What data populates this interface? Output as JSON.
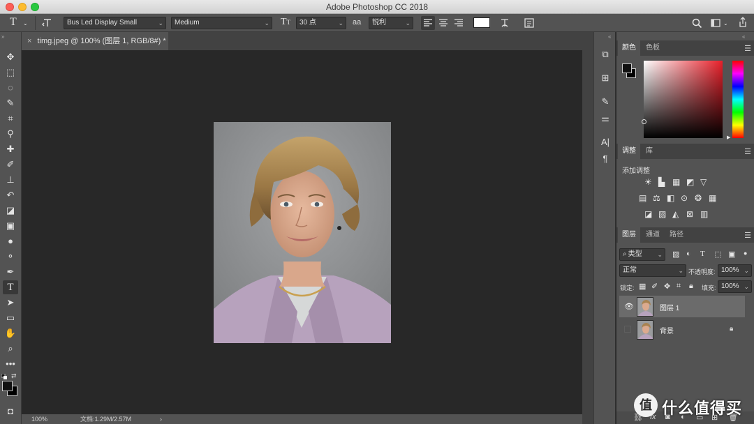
{
  "window": {
    "title": "Adobe Photoshop CC 2018"
  },
  "options_bar": {
    "font_family": "Bus Led Display Small",
    "font_style": "Medium",
    "font_size": "30 点",
    "aa_label": "aa",
    "antialias": "锐利",
    "text_color": "#ffffff"
  },
  "document": {
    "tab_title": "timg.jpeg @ 100% (图层 1, RGB/8#) *",
    "close": "×"
  },
  "status": {
    "zoom": "100%",
    "doc_info": "文档:1.29M/2.57M",
    "arrow": "›"
  },
  "panels": {
    "color": {
      "tabs": [
        "颜色",
        "色板"
      ]
    },
    "adjustments": {
      "tabs": [
        "调整",
        "库"
      ],
      "title": "添加调整"
    },
    "layers": {
      "tabs": [
        "图层",
        "通道",
        "路径"
      ],
      "filter": "类型",
      "blend_mode": "正常",
      "opacity_label": "不透明度:",
      "opacity": "100%",
      "lock_label": "锁定:",
      "fill_label": "填充:",
      "fill": "100%",
      "items": [
        {
          "name": "图层 1",
          "visible": true,
          "selected": true
        },
        {
          "name": "背景",
          "visible": false,
          "locked": true
        }
      ]
    }
  },
  "watermark": {
    "text": "什么值得买",
    "logo": "值"
  },
  "colors": {
    "accent_fg": "#111111",
    "accent_bg": "#000000"
  }
}
